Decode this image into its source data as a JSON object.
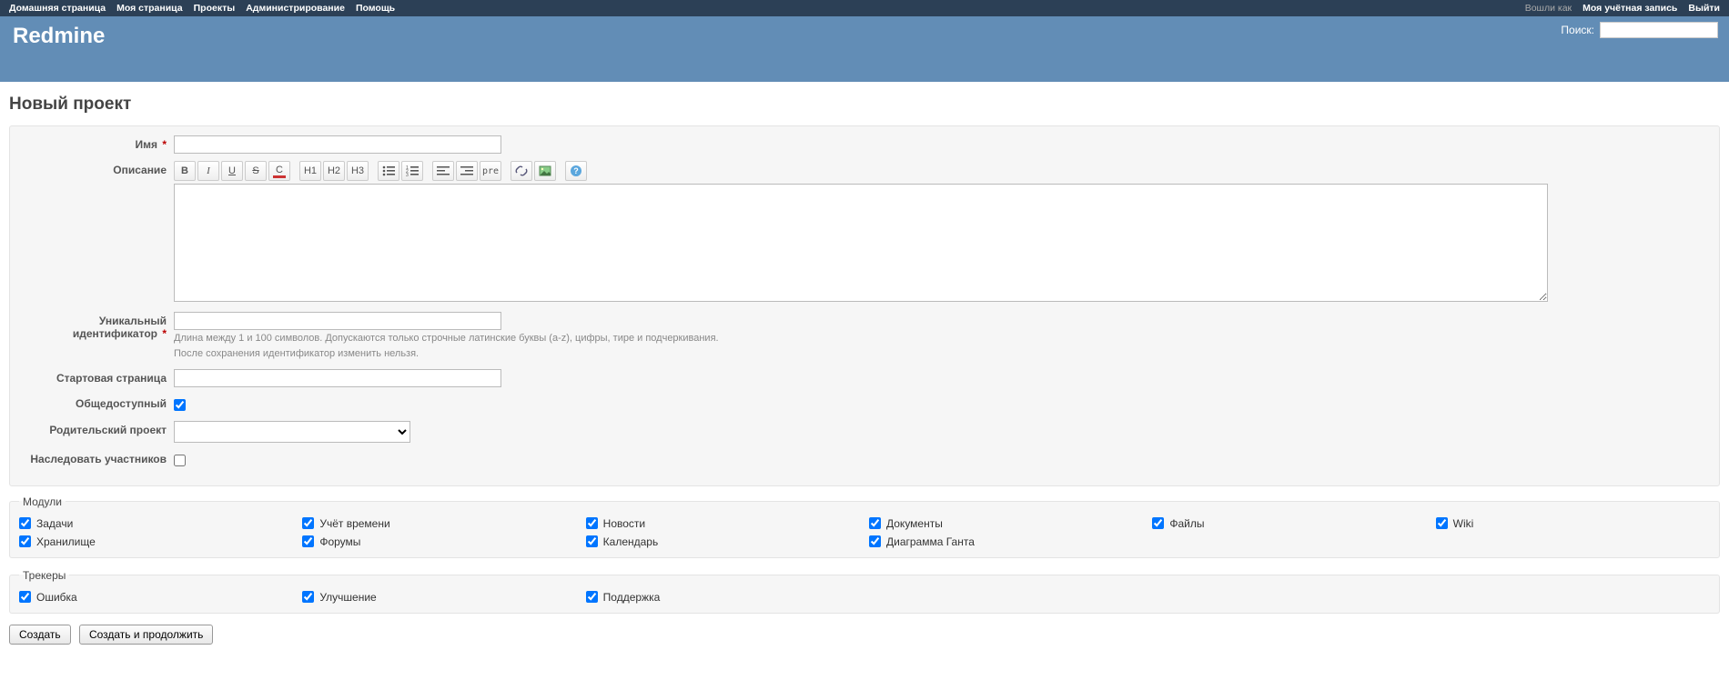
{
  "top_menu": {
    "left": [
      "Домашняя страница",
      "Моя страница",
      "Проекты",
      "Администрирование",
      "Помощь"
    ],
    "logged_in_prefix": "Вошли как",
    "right": [
      "Моя учётная запись",
      "Выйти"
    ]
  },
  "header": {
    "title": "Redmine",
    "search_label": "Поиск:",
    "search_value": ""
  },
  "page": {
    "title": "Новый проект"
  },
  "form": {
    "name_label": "Имя",
    "name_value": "",
    "description_label": "Описание",
    "description_value": "",
    "identifier_label": "Уникальный идентификатор",
    "identifier_value": "",
    "identifier_hint1": "Длина между 1 и 100 символов. Допускаются только строчные латинские буквы (a-z), цифры, тире и подчеркивания.",
    "identifier_hint2": "После сохранения идентификатор изменить нельзя.",
    "homepage_label": "Стартовая страница",
    "homepage_value": "",
    "public_label": "Общедоступный",
    "parent_label": "Родительский проект",
    "parent_value": "",
    "inherit_label": "Наследовать участников"
  },
  "toolbar": {
    "bold": "B",
    "italic": "I",
    "underline": "U",
    "strike": "S",
    "color": "C",
    "h1": "H1",
    "h2": "H2",
    "h3": "H3",
    "pre": "pre"
  },
  "modules": {
    "legend": "Модули",
    "items": [
      {
        "label": "Задачи",
        "checked": true
      },
      {
        "label": "Учёт времени",
        "checked": true
      },
      {
        "label": "Новости",
        "checked": true
      },
      {
        "label": "Документы",
        "checked": true
      },
      {
        "label": "Файлы",
        "checked": true
      },
      {
        "label": "Wiki",
        "checked": true
      },
      {
        "label": "Хранилище",
        "checked": true
      },
      {
        "label": "Форумы",
        "checked": true
      },
      {
        "label": "Календарь",
        "checked": true
      },
      {
        "label": "Диаграмма Ганта",
        "checked": true
      }
    ]
  },
  "trackers": {
    "legend": "Трекеры",
    "items": [
      {
        "label": "Ошибка",
        "checked": true
      },
      {
        "label": "Улучшение",
        "checked": true
      },
      {
        "label": "Поддержка",
        "checked": true
      }
    ]
  },
  "buttons": {
    "create": "Создать",
    "create_continue": "Создать и продолжить"
  }
}
